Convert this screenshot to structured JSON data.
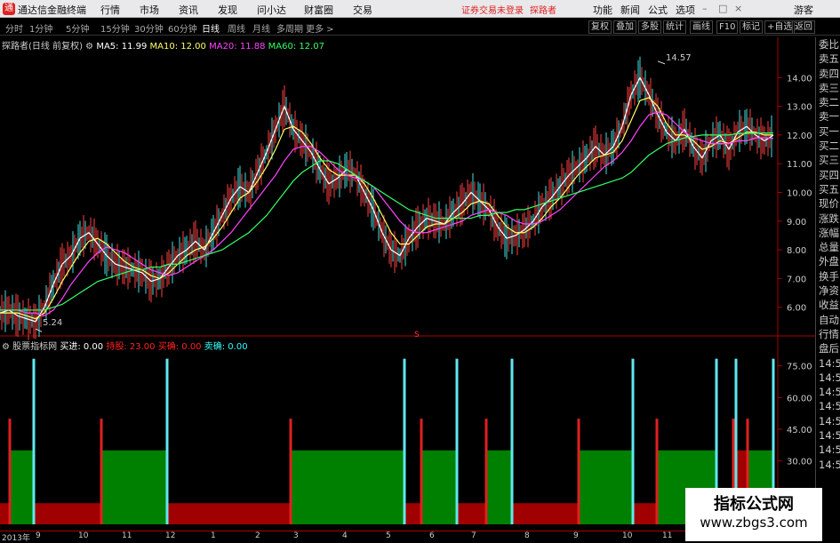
{
  "titlebar": {
    "logo": "通",
    "app_name": "通达信金融终端",
    "menu": [
      "行情",
      "市场",
      "资讯",
      "发现",
      "问小达",
      "财富圈",
      "交易"
    ],
    "notice": "证券交易未登录",
    "user": "探路者",
    "right_menu": [
      "功能",
      "新闻",
      "公式",
      "选项"
    ],
    "guest": "游客"
  },
  "toolbar": {
    "periods": [
      "分时",
      "1分钟",
      "5分钟",
      "15分钟",
      "30分钟",
      "60分钟",
      "日线",
      "周线",
      "月线",
      "多周期",
      "更多 >"
    ],
    "active_period": "日线",
    "right_buttons": [
      "复权",
      "叠加",
      "多股",
      "统计",
      "画线",
      "F10",
      "标记",
      "+自选",
      "返回"
    ]
  },
  "main_chart": {
    "stock_label": "探路者(日线 前复权)",
    "ma": [
      {
        "label": "MA5: 11.99",
        "color": "#ffffff"
      },
      {
        "label": "MA10: 12.00",
        "color": "#ffff66"
      },
      {
        "label": "MA20: 11.88",
        "color": "#ff44ff"
      },
      {
        "label": "MA60: 12.07",
        "color": "#33ff66"
      }
    ],
    "high_label": "14.57",
    "low_label": "5.24",
    "marker": "S"
  },
  "indicator": {
    "title": "股票指标网",
    "items": [
      {
        "label": "买进: 0.00",
        "color": "#ffffff"
      },
      {
        "label": "持股: 23.00",
        "color": "#ff2222"
      },
      {
        "label": "买确: 0.00",
        "color": "#ff2222"
      },
      {
        "label": "卖确: 0.00",
        "color": "#33ffff"
      }
    ]
  },
  "right_panel": [
    "委比",
    "卖五",
    "卖四",
    "卖三",
    "卖二",
    "卖一",
    "买一",
    "买二",
    "买三",
    "买四",
    "买五",
    "现价",
    "涨跌",
    "涨幅",
    "总量",
    "外盘",
    "换手",
    "净资",
    "收益",
    "自动",
    "行情",
    "盘后",
    "14:5",
    "14:5",
    "14:5",
    "14:5",
    "14:5",
    "14:5",
    "14:5",
    "14:5"
  ],
  "x_axis": [
    "2013年",
    "9",
    "10",
    "11",
    "12",
    "1",
    "2",
    "3",
    "4",
    "5",
    "6",
    "7",
    "8",
    "9",
    "10",
    "11"
  ],
  "watermark": {
    "line1": "指标公式网",
    "line2": "www.zbgs3.com"
  },
  "chart_data": [
    {
      "type": "line",
      "title": "探路者(日线 前复权)",
      "yaxis_ticks": [
        "14.00",
        "13.00",
        "12.00",
        "11.00",
        "10.00",
        "9.00",
        "8.00",
        "7.00",
        "6.00"
      ],
      "ylim": [
        5.0,
        15.0
      ],
      "annotations": [
        {
          "text": "14.57",
          "value": 14.57
        },
        {
          "text": "5.24",
          "value": 5.24
        }
      ],
      "x": [
        0,
        10,
        20,
        30,
        40,
        50,
        60,
        70,
        80,
        90,
        100,
        110,
        120,
        130,
        140,
        150,
        160,
        170,
        180,
        190,
        200,
        210,
        220,
        230,
        240,
        250,
        260,
        270,
        280,
        290,
        300,
        310,
        320,
        330,
        340,
        350,
        360,
        370,
        380,
        390,
        400,
        410,
        420,
        430,
        440,
        450,
        460,
        470,
        480,
        490,
        500,
        510,
        520,
        530,
        540,
        550,
        560,
        570,
        580,
        590,
        600,
        610,
        620,
        630,
        640,
        650,
        660,
        670,
        680,
        690,
        700,
        710,
        720,
        730,
        740,
        750,
        760,
        770,
        780,
        790,
        800,
        810,
        820,
        830,
        840,
        850,
        860,
        870
      ],
      "series": [
        {
          "name": "MA5",
          "color": "#ffffff",
          "values": [
            5.8,
            5.9,
            5.7,
            5.6,
            5.5,
            6.0,
            6.8,
            7.5,
            7.8,
            8.4,
            8.6,
            8.2,
            7.8,
            7.5,
            7.4,
            7.3,
            7.2,
            6.9,
            7.0,
            7.4,
            7.8,
            8.0,
            8.3,
            8.0,
            8.6,
            9.2,
            9.8,
            10.2,
            10.0,
            10.7,
            11.4,
            12.2,
            13.0,
            12.2,
            11.8,
            11.4,
            10.8,
            10.3,
            10.5,
            10.8,
            10.6,
            10.0,
            9.4,
            8.6,
            8.0,
            7.8,
            8.4,
            8.8,
            9.1,
            9.0,
            8.9,
            9.3,
            9.6,
            10.0,
            9.7,
            9.4,
            8.8,
            8.4,
            8.5,
            8.7,
            9.0,
            9.5,
            9.8,
            10.2,
            10.6,
            10.9,
            11.2,
            11.6,
            11.3,
            11.6,
            12.3,
            13.4,
            14.0,
            13.4,
            12.7,
            12.1,
            11.8,
            12.2,
            11.6,
            11.2,
            11.8,
            12.0,
            11.5,
            12.1,
            12.3,
            12.0,
            11.8,
            11.99
          ]
        },
        {
          "name": "MA10",
          "color": "#ffff66",
          "values": [
            5.8,
            5.8,
            5.8,
            5.7,
            5.6,
            5.8,
            6.3,
            6.9,
            7.4,
            7.9,
            8.3,
            8.4,
            8.2,
            7.9,
            7.6,
            7.4,
            7.3,
            7.1,
            7.0,
            7.2,
            7.5,
            7.8,
            8.0,
            8.1,
            8.4,
            8.8,
            9.3,
            9.8,
            10.0,
            10.4,
            10.9,
            11.5,
            12.2,
            12.3,
            12.1,
            11.7,
            11.2,
            10.8,
            10.6,
            10.6,
            10.6,
            10.3,
            9.8,
            9.2,
            8.6,
            8.2,
            8.2,
            8.5,
            8.8,
            8.9,
            8.9,
            9.1,
            9.3,
            9.6,
            9.7,
            9.6,
            9.2,
            8.8,
            8.6,
            8.6,
            8.8,
            9.1,
            9.5,
            9.8,
            10.2,
            10.6,
            10.9,
            11.2,
            11.3,
            11.4,
            11.8,
            12.5,
            13.2,
            13.3,
            13.0,
            12.4,
            12.0,
            12.0,
            11.8,
            11.5,
            11.6,
            11.8,
            11.7,
            11.9,
            12.1,
            12.1,
            12.0,
            12.0
          ]
        },
        {
          "name": "MA20",
          "color": "#ff44ff",
          "values": [
            5.9,
            5.9,
            5.9,
            5.8,
            5.8,
            5.7,
            5.9,
            6.3,
            6.8,
            7.2,
            7.6,
            7.9,
            8.1,
            8.0,
            7.9,
            7.7,
            7.5,
            7.3,
            7.2,
            7.1,
            7.2,
            7.4,
            7.6,
            7.8,
            8.0,
            8.3,
            8.6,
            9.0,
            9.4,
            9.8,
            10.2,
            10.6,
            11.1,
            11.5,
            11.6,
            11.6,
            11.4,
            11.1,
            10.8,
            10.6,
            10.5,
            10.4,
            10.2,
            9.8,
            9.4,
            9.0,
            8.7,
            8.6,
            8.6,
            8.7,
            8.8,
            8.9,
            9.0,
            9.2,
            9.3,
            9.4,
            9.3,
            9.2,
            9.0,
            8.9,
            8.9,
            9.0,
            9.2,
            9.4,
            9.7,
            10.0,
            10.3,
            10.6,
            10.9,
            11.1,
            11.4,
            11.8,
            12.3,
            12.7,
            12.8,
            12.7,
            12.4,
            12.1,
            11.9,
            11.8,
            11.7,
            11.7,
            11.7,
            11.8,
            11.8,
            11.9,
            11.9,
            11.88
          ]
        },
        {
          "name": "MA60",
          "color": "#33ff66",
          "values": [
            5.9,
            5.9,
            5.9,
            5.9,
            5.9,
            5.9,
            6.0,
            6.1,
            6.3,
            6.5,
            6.7,
            6.9,
            7.0,
            7.1,
            7.2,
            7.3,
            7.3,
            7.4,
            7.4,
            7.5,
            7.5,
            7.6,
            7.7,
            7.8,
            7.9,
            8.0,
            8.2,
            8.4,
            8.6,
            8.9,
            9.2,
            9.6,
            10.0,
            10.4,
            10.7,
            10.9,
            11.1,
            11.1,
            11.0,
            10.8,
            10.6,
            10.4,
            10.2,
            10.0,
            9.8,
            9.6,
            9.4,
            9.3,
            9.2,
            9.1,
            9.1,
            9.1,
            9.1,
            9.1,
            9.2,
            9.2,
            9.3,
            9.3,
            9.4,
            9.4,
            9.5,
            9.6,
            9.7,
            9.8,
            9.9,
            10.0,
            10.1,
            10.2,
            10.3,
            10.4,
            10.5,
            10.7,
            11.0,
            11.3,
            11.5,
            11.7,
            11.8,
            11.9,
            11.95,
            12.0,
            12.0,
            12.0,
            12.0,
            12.05,
            12.05,
            12.06,
            12.07,
            12.07
          ]
        }
      ]
    },
    {
      "type": "bar",
      "title": "股票指标网",
      "yaxis_ticks": [
        "75.00",
        "60.00",
        "45.00",
        "30.00"
      ],
      "ylim": [
        0,
        82
      ],
      "segments": [
        {
          "x0": 0,
          "x1": 12,
          "value": 10,
          "color": "red"
        },
        {
          "x0": 12,
          "x1": 38,
          "value": 35,
          "color": "green"
        },
        {
          "x0": 38,
          "x1": 115,
          "value": 10,
          "color": "red"
        },
        {
          "x0": 115,
          "x1": 188,
          "value": 35,
          "color": "green"
        },
        {
          "x0": 188,
          "x1": 328,
          "value": 10,
          "color": "red"
        },
        {
          "x0": 328,
          "x1": 455,
          "value": 35,
          "color": "green"
        },
        {
          "x0": 455,
          "x1": 475,
          "value": 10,
          "color": "red"
        },
        {
          "x0": 475,
          "x1": 514,
          "value": 35,
          "color": "green"
        },
        {
          "x0": 514,
          "x1": 548,
          "value": 10,
          "color": "red"
        },
        {
          "x0": 548,
          "x1": 576,
          "value": 35,
          "color": "green"
        },
        {
          "x0": 576,
          "x1": 652,
          "value": 10,
          "color": "red"
        },
        {
          "x0": 652,
          "x1": 712,
          "value": 35,
          "color": "green"
        },
        {
          "x0": 712,
          "x1": 740,
          "value": 10,
          "color": "red"
        },
        {
          "x0": 740,
          "x1": 806,
          "value": 35,
          "color": "green"
        },
        {
          "x0": 806,
          "x1": 826,
          "value": 10,
          "color": "red"
        },
        {
          "x0": 826,
          "x1": 842,
          "value": 35,
          "color": "red"
        },
        {
          "x0": 842,
          "x1": 870,
          "value": 35,
          "color": "green"
        }
      ],
      "red_spikes": [
        {
          "x": 11,
          "value": 50
        },
        {
          "x": 114,
          "value": 50
        },
        {
          "x": 327,
          "value": 50
        },
        {
          "x": 474,
          "value": 50
        },
        {
          "x": 547,
          "value": 50
        },
        {
          "x": 651,
          "value": 50
        },
        {
          "x": 739,
          "value": 50
        },
        {
          "x": 825,
          "value": 50
        },
        {
          "x": 841,
          "value": 50
        }
      ],
      "cyan_spikes": [
        {
          "x": 38,
          "value": 75
        },
        {
          "x": 188,
          "value": 75
        },
        {
          "x": 455,
          "value": 75
        },
        {
          "x": 514,
          "value": 75
        },
        {
          "x": 576,
          "value": 75
        },
        {
          "x": 712,
          "value": 75
        },
        {
          "x": 806,
          "value": 75
        },
        {
          "x": 828,
          "value": 75
        },
        {
          "x": 870,
          "value": 75
        }
      ]
    }
  ]
}
